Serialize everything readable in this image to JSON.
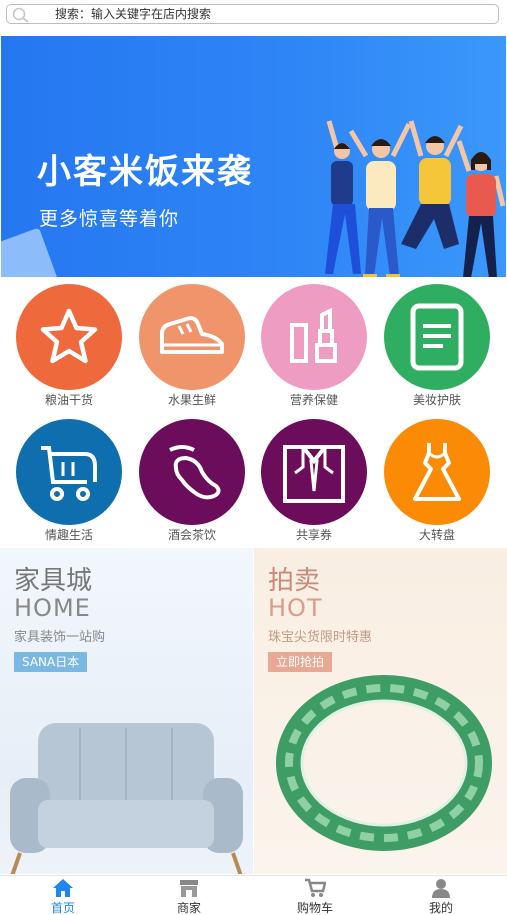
{
  "search": {
    "placeholder": "搜索：输入关键字在店内搜索"
  },
  "banner": {
    "title": "小客米饭来袭",
    "subtitle": "更多惊喜等着你"
  },
  "categories": [
    {
      "label": "粮油干货",
      "icon": "star-icon",
      "color": "#ee6a3c"
    },
    {
      "label": "水果生鲜",
      "icon": "sneaker-icon",
      "color": "#f0956b"
    },
    {
      "label": "营养保健",
      "icon": "lipstick-icon",
      "color": "#ef9cc2"
    },
    {
      "label": "美妆护肤",
      "icon": "document-icon",
      "color": "#2fae62"
    },
    {
      "label": "情趣生活",
      "icon": "cart-icon",
      "color": "#0f6fae"
    },
    {
      "label": "酒会茶饮",
      "icon": "footprint-icon",
      "color": "#6c0d5c"
    },
    {
      "label": "共享券",
      "icon": "shirt-icon",
      "color": "#6c0d5c"
    },
    {
      "label": "大转盘",
      "icon": "dress-icon",
      "color": "#fb8a05"
    }
  ],
  "promos": {
    "furniture": {
      "title": "家具城",
      "sub": "HOME",
      "desc": "家具装饰一站购",
      "tag": "SANA日本"
    },
    "auction": {
      "title": "拍卖",
      "sub": "HOT",
      "desc": "珠宝尖货限时特惠",
      "tag": "立即抢拍"
    }
  },
  "tabbar": [
    {
      "label": "首页",
      "icon": "home-icon",
      "active": true
    },
    {
      "label": "商家",
      "icon": "shop-icon",
      "active": false
    },
    {
      "label": "购物车",
      "icon": "cart-icon",
      "active": false
    },
    {
      "label": "我的",
      "icon": "user-icon",
      "active": false
    }
  ],
  "colors": {
    "accent": "#1d86f0",
    "tab_inactive": "#333333"
  }
}
